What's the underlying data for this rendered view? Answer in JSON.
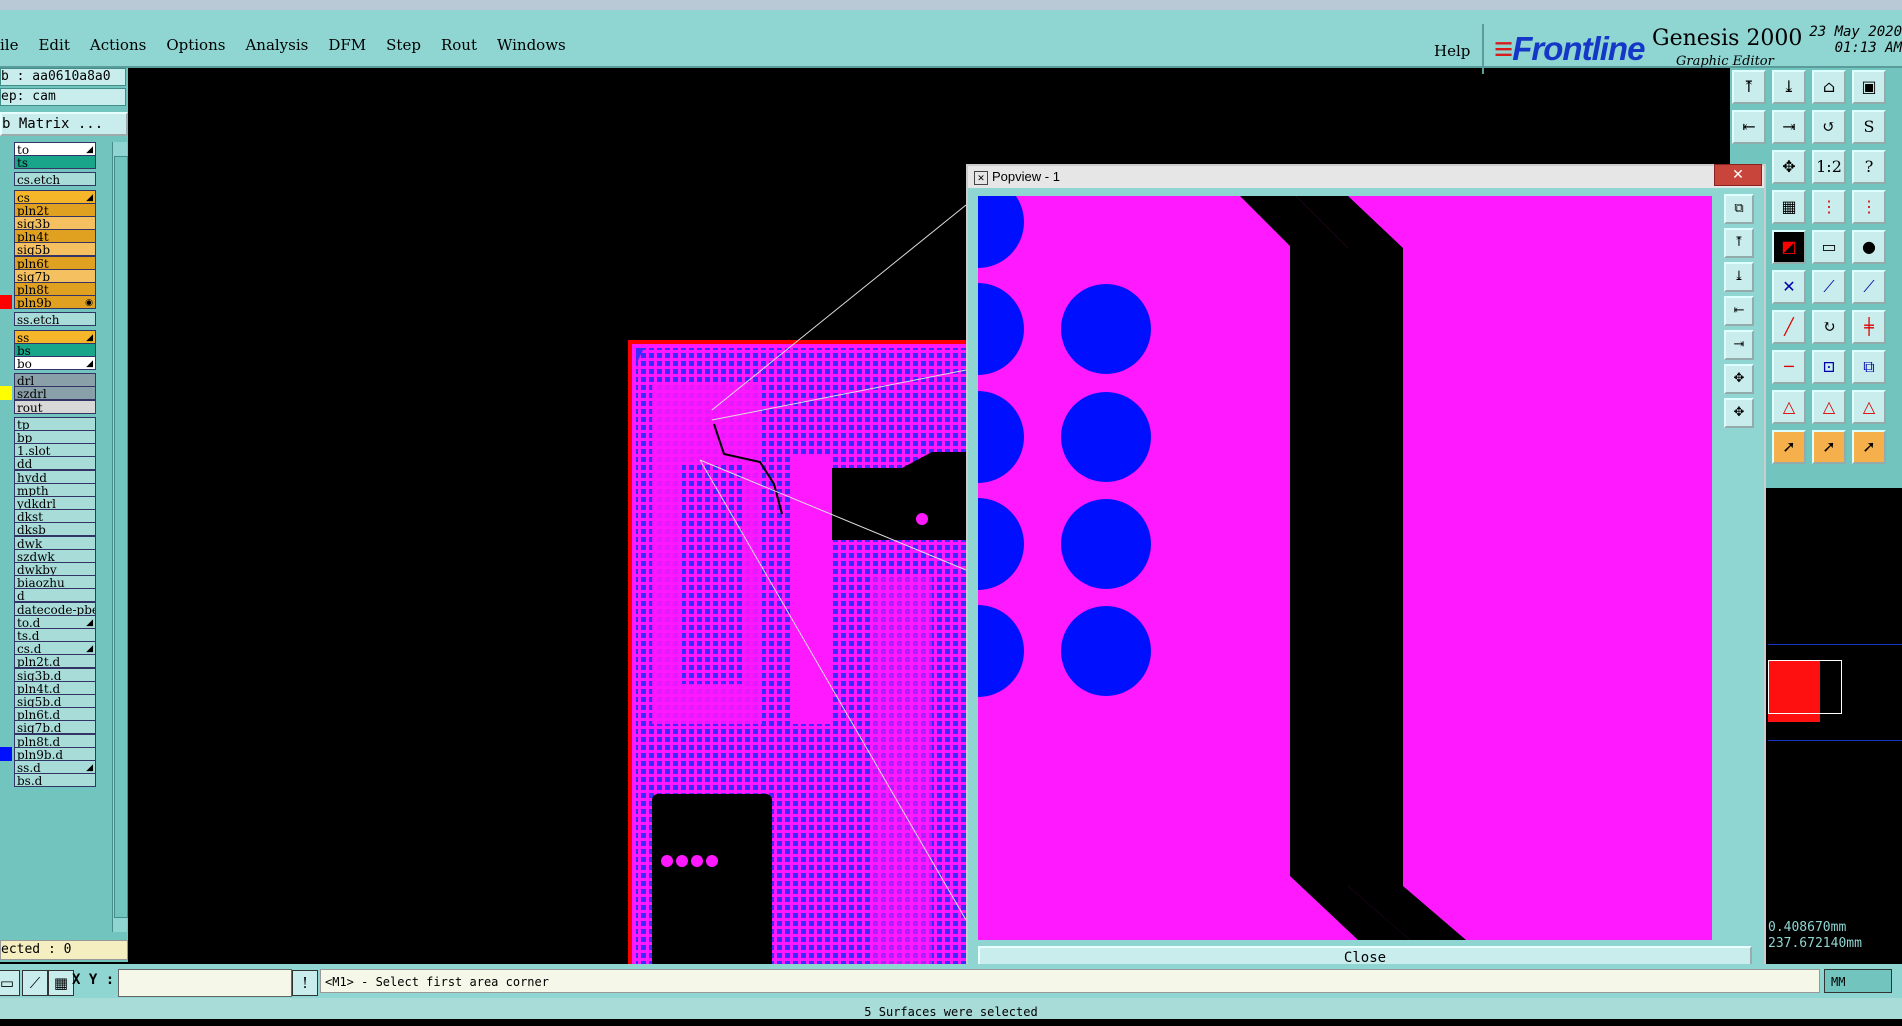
{
  "menu": {
    "items": [
      "ile",
      "Edit",
      "Actions",
      "Options",
      "Analysis",
      "DFM",
      "Step",
      "Rout",
      "Windows"
    ],
    "help": "Help"
  },
  "brand": {
    "logo": "Frontline",
    "app": "Genesis 2000",
    "subtitle": "Graphic Editor",
    "date": "23 May 2020",
    "time": "01:13 AM"
  },
  "left": {
    "job": "b : aa0610a8a0",
    "step": "ep: cam",
    "matrix": "b Matrix ...",
    "selected": "ected : 0"
  },
  "layers": [
    {
      "name": "to",
      "bg": "#ffffff",
      "mark": "◢",
      "swatch": ""
    },
    {
      "name": "ts",
      "bg": "#19a58a",
      "mark": "",
      "swatch": ""
    },
    {
      "name": "cs.etch",
      "bg": "#a8dcd9",
      "mark": "",
      "swatch": ""
    },
    {
      "name": "cs",
      "bg": "#f5b629",
      "mark": "◢",
      "swatch": ""
    },
    {
      "name": "pln2t",
      "bg": "#e0a020",
      "mark": "",
      "swatch": ""
    },
    {
      "name": "sig3b",
      "bg": "#f5c060",
      "mark": "",
      "swatch": ""
    },
    {
      "name": "pln4t",
      "bg": "#e0a020",
      "mark": "",
      "swatch": ""
    },
    {
      "name": "sig5b",
      "bg": "#f5c060",
      "mark": "",
      "swatch": ""
    },
    {
      "name": "pln6t",
      "bg": "#e0a020",
      "mark": "",
      "swatch": ""
    },
    {
      "name": "sig7b",
      "bg": "#f5c060",
      "mark": "",
      "swatch": ""
    },
    {
      "name": "pln8t",
      "bg": "#e0a020",
      "mark": "",
      "swatch": ""
    },
    {
      "name": "pln9b",
      "bg": "#e0a020",
      "mark": "◉",
      "swatch": "#ff0000"
    },
    {
      "name": "ss.etch",
      "bg": "#a8dcd9",
      "mark": "",
      "swatch": ""
    },
    {
      "name": "ss",
      "bg": "#f5b629",
      "mark": "◢",
      "swatch": ""
    },
    {
      "name": "bs",
      "bg": "#19a58a",
      "mark": "",
      "swatch": ""
    },
    {
      "name": "bo",
      "bg": "#ffffff",
      "mark": "◢",
      "swatch": ""
    },
    {
      "name": "drl",
      "bg": "#8aa0a8",
      "mark": "",
      "swatch": ""
    },
    {
      "name": "szdrl",
      "bg": "#8aa0a8",
      "mark": "",
      "swatch": "#ffff00"
    },
    {
      "name": "rout",
      "bg": "#d8d8d8",
      "mark": "",
      "swatch": ""
    },
    {
      "name": "tp",
      "bg": "#a8dcd9",
      "mark": "",
      "swatch": ""
    },
    {
      "name": "bp",
      "bg": "#a8dcd9",
      "mark": "",
      "swatch": ""
    },
    {
      "name": "1.slot",
      "bg": "#a8dcd9",
      "mark": "",
      "swatch": ""
    },
    {
      "name": "dd",
      "bg": "#a8dcd9",
      "mark": "",
      "swatch": ""
    },
    {
      "name": "hydd",
      "bg": "#a8dcd9",
      "mark": "",
      "swatch": ""
    },
    {
      "name": "mpth",
      "bg": "#a8dcd9",
      "mark": "",
      "swatch": ""
    },
    {
      "name": "ydkdrl",
      "bg": "#a8dcd9",
      "mark": "",
      "swatch": ""
    },
    {
      "name": "dkst",
      "bg": "#a8dcd9",
      "mark": "",
      "swatch": ""
    },
    {
      "name": "dksb",
      "bg": "#a8dcd9",
      "mark": "",
      "swatch": ""
    },
    {
      "name": "dwk",
      "bg": "#a8dcd9",
      "mark": "",
      "swatch": ""
    },
    {
      "name": "szdwk",
      "bg": "#a8dcd9",
      "mark": "",
      "swatch": ""
    },
    {
      "name": "dwkby",
      "bg": "#a8dcd9",
      "mark": "",
      "swatch": ""
    },
    {
      "name": "biaozhu",
      "bg": "#a8dcd9",
      "mark": "",
      "swatch": ""
    },
    {
      "name": "d",
      "bg": "#a8dcd9",
      "mark": "",
      "swatch": ""
    },
    {
      "name": "datecode-pbe",
      "bg": "#a8dcd9",
      "mark": "",
      "swatch": ""
    },
    {
      "name": "to.d",
      "bg": "#a8dcd9",
      "mark": "◢",
      "swatch": ""
    },
    {
      "name": "ts.d",
      "bg": "#a8dcd9",
      "mark": "",
      "swatch": ""
    },
    {
      "name": "cs.d",
      "bg": "#a8dcd9",
      "mark": "◢",
      "swatch": ""
    },
    {
      "name": "pln2t.d",
      "bg": "#a8dcd9",
      "mark": "",
      "swatch": ""
    },
    {
      "name": "sig3b.d",
      "bg": "#a8dcd9",
      "mark": "",
      "swatch": ""
    },
    {
      "name": "pln4t.d",
      "bg": "#a8dcd9",
      "mark": "",
      "swatch": ""
    },
    {
      "name": "sig5b.d",
      "bg": "#a8dcd9",
      "mark": "",
      "swatch": ""
    },
    {
      "name": "pln6t.d",
      "bg": "#a8dcd9",
      "mark": "",
      "swatch": ""
    },
    {
      "name": "sig7b.d",
      "bg": "#a8dcd9",
      "mark": "",
      "swatch": ""
    },
    {
      "name": "pln8t.d",
      "bg": "#a8dcd9",
      "mark": "",
      "swatch": ""
    },
    {
      "name": "pln9b.d",
      "bg": "#a8dcd9",
      "mark": "",
      "swatch": "#0010ff"
    },
    {
      "name": "ss.d",
      "bg": "#a8dcd9",
      "mark": "◢",
      "swatch": ""
    },
    {
      "name": "bs.d",
      "bg": "#a8dcd9",
      "mark": "",
      "swatch": ""
    }
  ],
  "bottom": {
    "xy_label": "X Y :",
    "prompt": "<M1> - Select first area corner",
    "units": "MM",
    "status": "5 Surfaces were selected"
  },
  "coords": {
    "x": "0.408670mm",
    "y": "237.672140mm"
  },
  "popup": {
    "title": "Popview - 1",
    "close_x": "✕",
    "close": "Close"
  },
  "colors": {
    "panel": "#72c4bf",
    "copper": "#ff19ff",
    "pad": "#0010ff",
    "outline": "#ff0000"
  },
  "toolbar": {
    "labels": [
      "1:2",
      "?"
    ]
  }
}
